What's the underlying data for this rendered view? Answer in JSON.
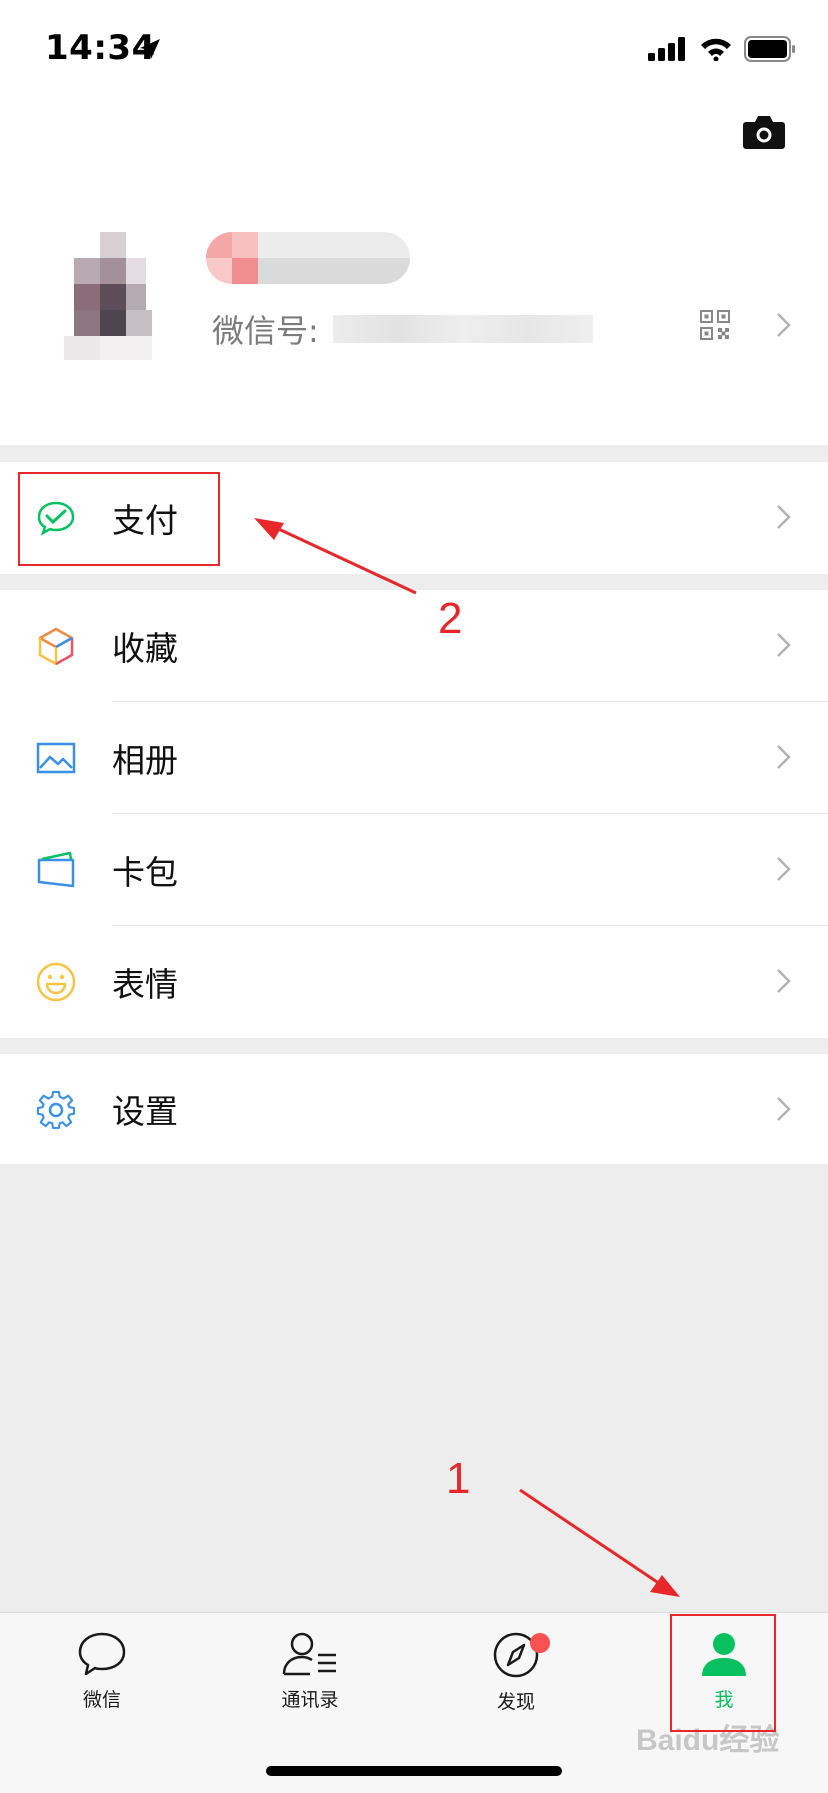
{
  "status_bar": {
    "time": "14:34"
  },
  "profile": {
    "wechat_id_label": "微信号:"
  },
  "menu": {
    "pay": "支付",
    "favorites": "收藏",
    "moments": "相册",
    "cards": "卡包",
    "stickers": "表情",
    "settings": "设置"
  },
  "annotations": {
    "step1": "1",
    "step2": "2"
  },
  "tabs": [
    {
      "label": "微信"
    },
    {
      "label": "通讯录"
    },
    {
      "label": "发现",
      "badge": true
    },
    {
      "label": "我",
      "active": true
    }
  ],
  "colors": {
    "accent": "#07c160",
    "annotation": "#e8272a",
    "badge": "#fa5151"
  },
  "watermark": "Baidu经验"
}
